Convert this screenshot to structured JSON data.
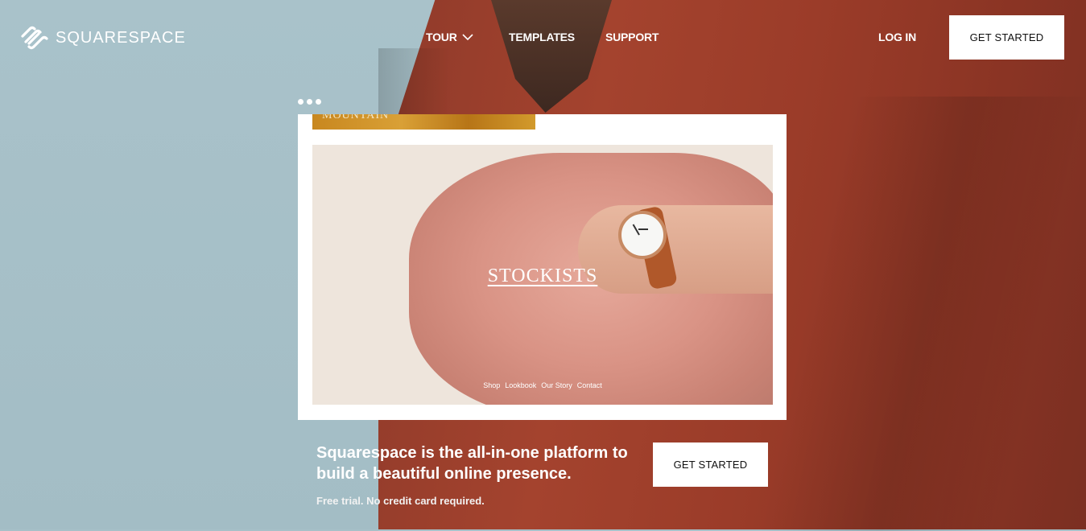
{
  "header": {
    "logo_text": "SQUARESPACE",
    "nav": {
      "tour": "TOUR",
      "templates": "TEMPLATES",
      "support": "SUPPORT",
      "login": "LOG IN"
    },
    "cta": "GET STARTED"
  },
  "preview": {
    "top_label": "MOUNTAIN",
    "title": "STOCKISTS",
    "nav_items": [
      "Shop",
      "Lookbook",
      "Our Story",
      "Contact"
    ]
  },
  "hero": {
    "headline": "Squarespace is the all-in-one platform to build a beautiful online presence.",
    "subline": "Free trial. No credit card required.",
    "cta": "GET STARTED"
  },
  "colors": {
    "background_blue": "#a7c0c8",
    "coat_red": "#9b3c29",
    "button_bg": "#ffffff"
  }
}
